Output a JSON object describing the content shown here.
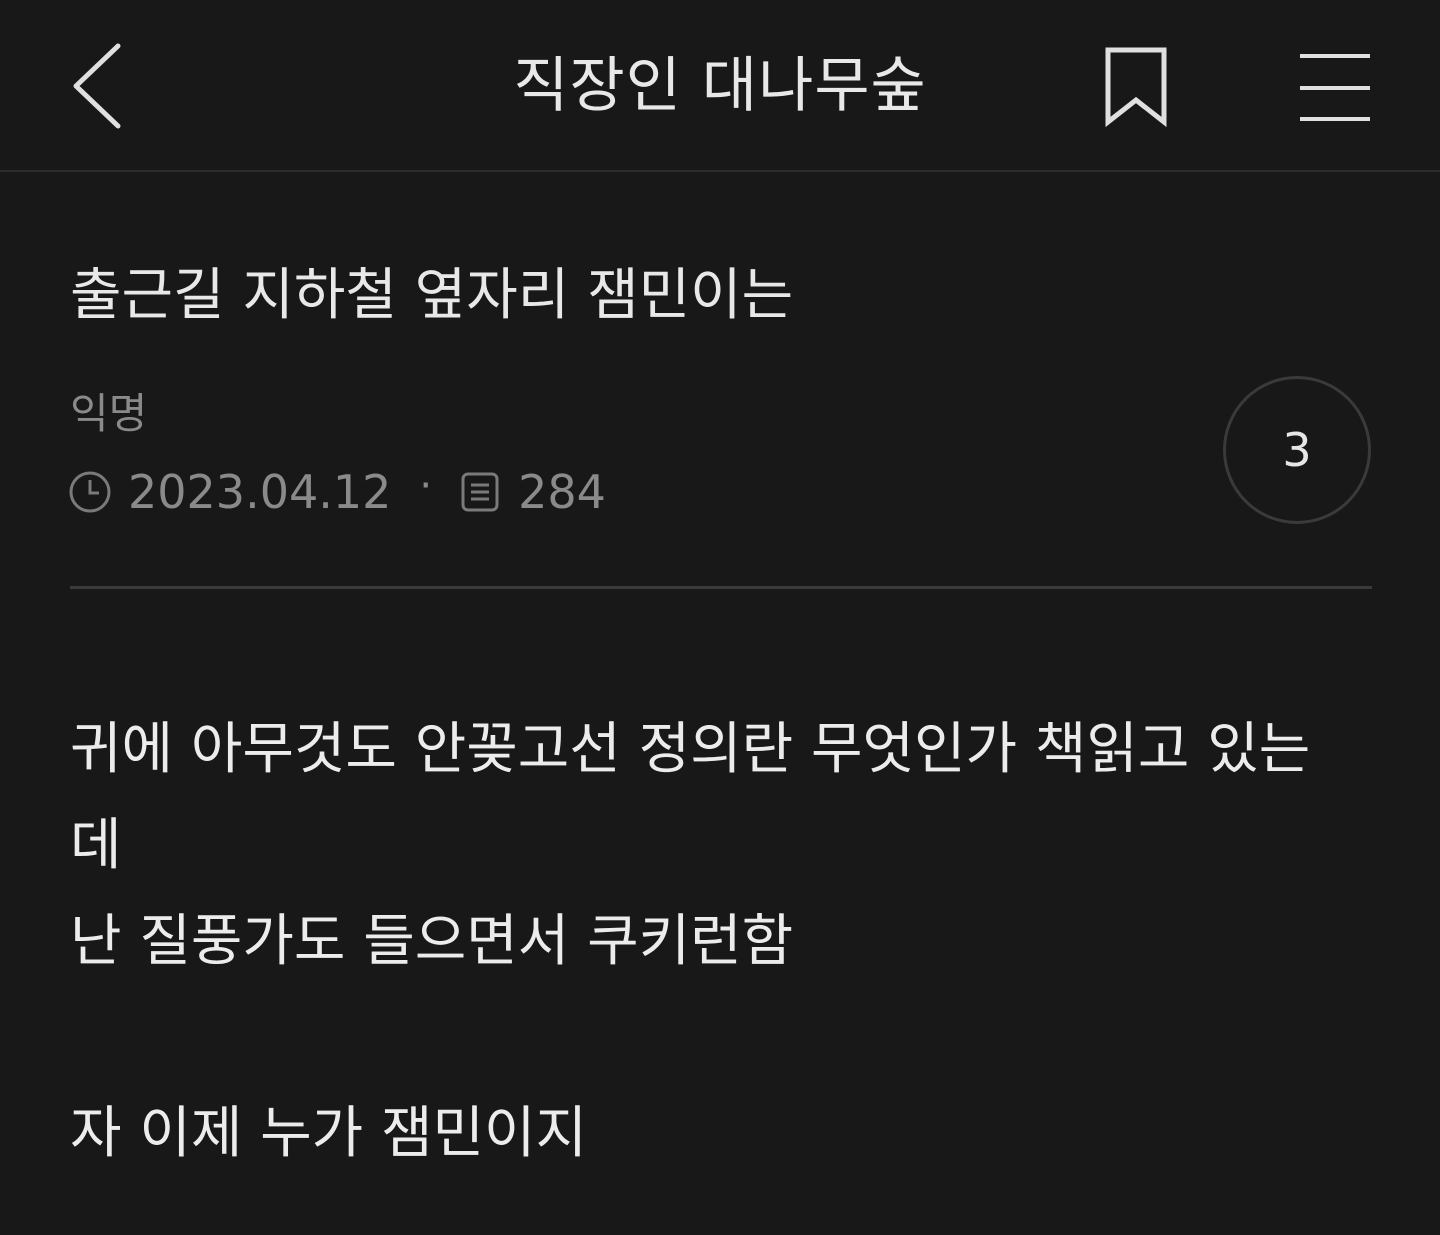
{
  "header": {
    "board_title": "직장인 대나무숲",
    "back_icon": "chevron-left-icon",
    "bookmark_icon": "bookmark-icon",
    "menu_icon": "hamburger-menu-icon"
  },
  "post": {
    "title": "출근길 지하철 옆자리 잼민이는",
    "author": "익명",
    "date": "2023.04.12",
    "views": "284",
    "separator": "·",
    "comment_count": "3",
    "body_lines": [
      "귀에 아무것도 안꽂고선 정의란 무엇인가 책읽고 있는",
      "데",
      "난 질풍가도 들으면서 쿠키런함",
      "",
      "자 이제 누가 잼민이지"
    ]
  },
  "colors": {
    "background": "#181818",
    "text": "#e6e6e6",
    "muted": "#8a8a8a",
    "divider": "#3a3a3a"
  }
}
